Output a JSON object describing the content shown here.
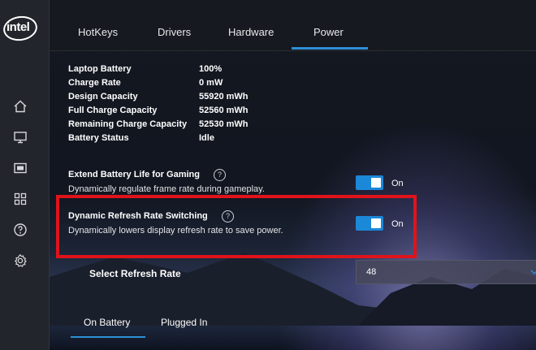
{
  "brand": {
    "logo_text": "intel"
  },
  "sidebar": {
    "items": [
      {
        "icon": "home-icon"
      },
      {
        "icon": "display-icon"
      },
      {
        "icon": "video-icon"
      },
      {
        "icon": "apps-grid-icon"
      },
      {
        "icon": "help-icon"
      },
      {
        "icon": "gear-icon"
      }
    ]
  },
  "tabs": [
    {
      "label": "HotKeys"
    },
    {
      "label": "Drivers"
    },
    {
      "label": "Hardware"
    },
    {
      "label": "Power",
      "active": true
    }
  ],
  "battery_info": [
    {
      "label": "Laptop Battery",
      "value": "100%"
    },
    {
      "label": "Charge Rate",
      "value": "0 mW"
    },
    {
      "label": "Design Capacity",
      "value": "55920 mWh"
    },
    {
      "label": "Full Charge Capacity",
      "value": "52560 mWh"
    },
    {
      "label": "Remaining Charge Capacity",
      "value": "52530 mWh"
    },
    {
      "label": "Battery Status",
      "value": "Idle"
    }
  ],
  "settings": {
    "extend_battery": {
      "title": "Extend Battery Life for Gaming",
      "description": "Dynamically regulate frame rate during gameplay.",
      "state_label": "On",
      "enabled": true
    },
    "dynamic_refresh": {
      "title": "Dynamic Refresh Rate Switching",
      "description": "Dynamically lowers display refresh rate to save power.",
      "state_label": "On",
      "enabled": true
    }
  },
  "refresh_rate": {
    "label": "Select Refresh Rate",
    "value": "48"
  },
  "power_tabs": [
    {
      "label": "On Battery",
      "active": true
    },
    {
      "label": "Plugged In"
    }
  ],
  "colors": {
    "accent": "#2d8fd5",
    "toggle_on": "#1b88d8",
    "highlight": "#e0131a",
    "sidebar_bg": "#22252b"
  }
}
